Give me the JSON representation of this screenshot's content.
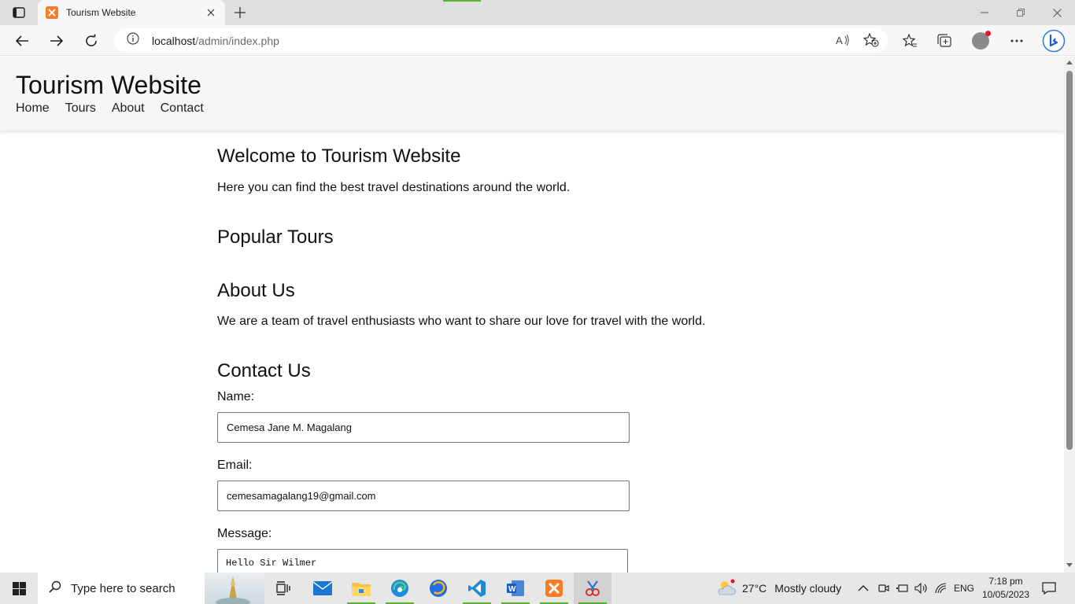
{
  "browser": {
    "tab": {
      "title": "Tourism Website"
    },
    "address": {
      "host": "localhost",
      "path": "/admin/index.php"
    }
  },
  "site": {
    "title": "Tourism Website",
    "nav": [
      {
        "label": "Home"
      },
      {
        "label": "Tours"
      },
      {
        "label": "About"
      },
      {
        "label": "Contact"
      }
    ]
  },
  "main": {
    "welcome_heading": "Welcome to Tourism Website",
    "welcome_text": "Here you can find the best travel destinations around the world.",
    "tours_heading": "Popular Tours",
    "about_heading": "About Us",
    "about_text": "We are a team of travel enthusiasts who want to share our love for travel with the world.",
    "contact": {
      "heading": "Contact Us",
      "name_label": "Name:",
      "name_value": "Cemesa Jane M. Magalang",
      "email_label": "Email:",
      "email_value": "cemesamagalang19@gmail.com",
      "message_label": "Message:",
      "message_value": "Hello Sir Wilmer"
    }
  },
  "taskbar": {
    "search_placeholder": "Type here to search",
    "weather_temp": "27°C",
    "weather_text": "Mostly cloudy",
    "language": "ENG",
    "time": "7:18 pm",
    "date": "10/05/2023"
  },
  "colors": {
    "accent_orange": "#fb7a24",
    "taskbar_active": "#5bb12f",
    "header_bg": "#f6f6f6"
  }
}
